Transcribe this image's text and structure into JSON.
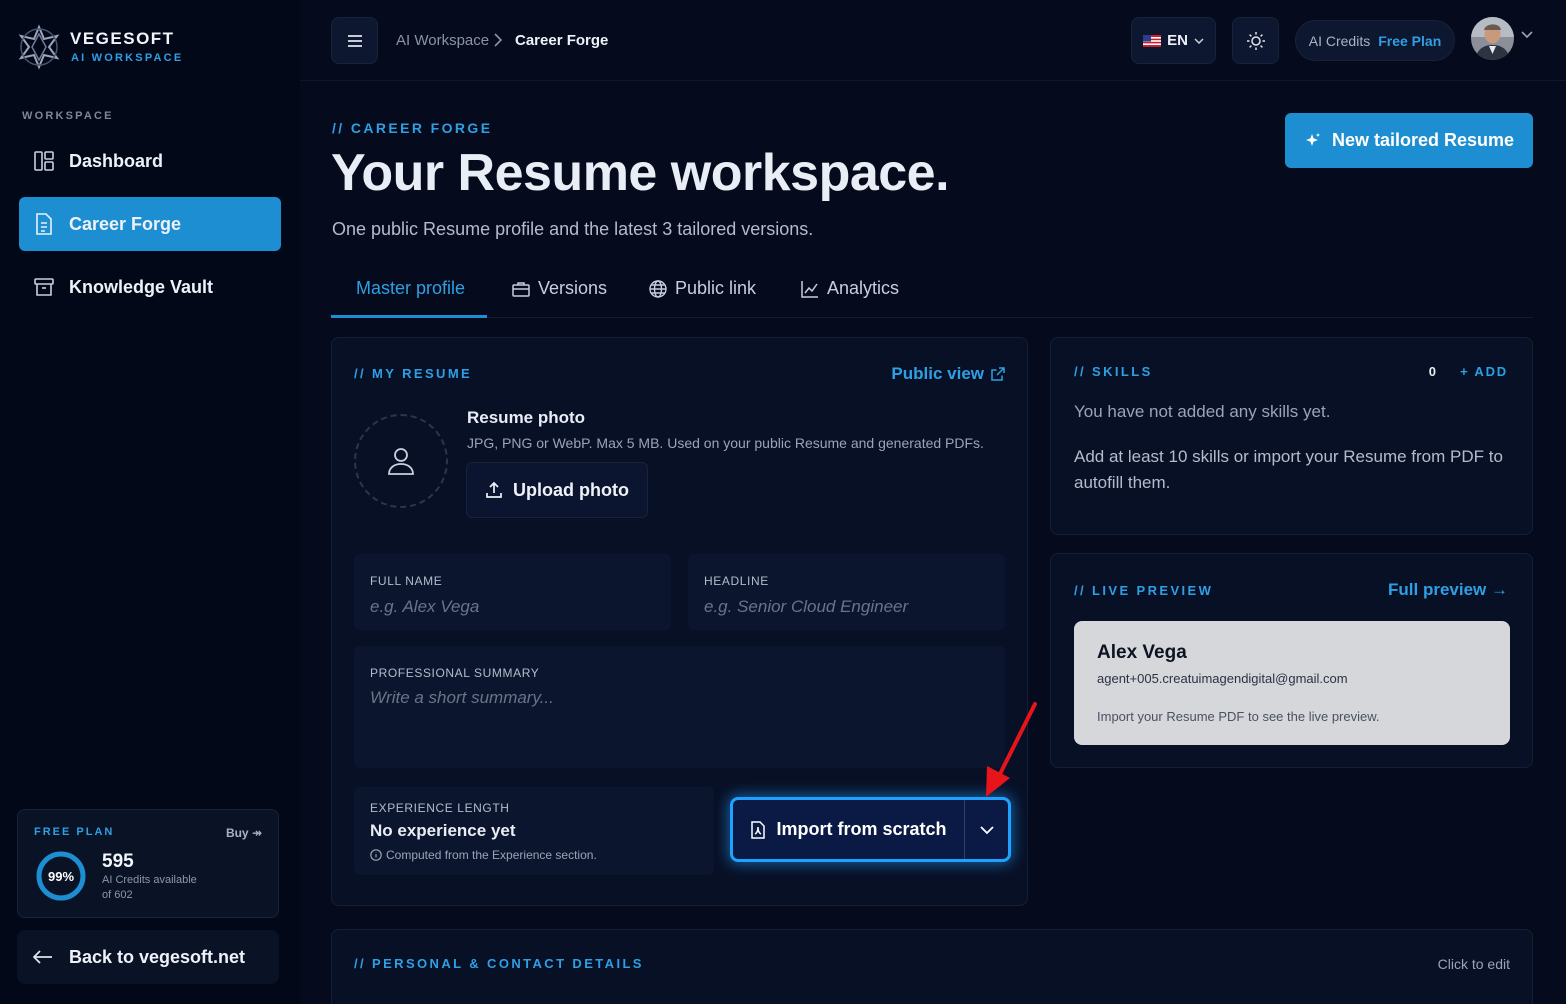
{
  "brand": {
    "name": "VEGESOFT",
    "subtitle": "AI WORKSPACE"
  },
  "sidebar": {
    "section_label": "WORKSPACE",
    "items": [
      {
        "label": "Dashboard",
        "icon": "layout-icon",
        "active": false
      },
      {
        "label": "Career Forge",
        "icon": "document-icon",
        "active": true
      },
      {
        "label": "Knowledge Vault",
        "icon": "archive-icon",
        "active": false
      }
    ],
    "plan": {
      "label": "FREE PLAN",
      "buy": "Buy ↠",
      "percent_text": "99%",
      "percent": 0.99,
      "credits": "595",
      "available_text": "AI Credits available",
      "of_text": "of 602"
    },
    "back_link": "Back to vegesoft.net"
  },
  "topbar": {
    "breadcrumb": [
      "AI Workspace",
      "Career Forge"
    ],
    "language": "EN",
    "credits_label": "AI Credits",
    "credits_plan": "Free Plan"
  },
  "header": {
    "eyebrow": "// CAREER FORGE",
    "title": "Your Resume workspace.",
    "subtitle": "One public Resume profile and the latest 3 tailored versions.",
    "new_button": "New tailored Resume"
  },
  "tabs": [
    {
      "label": "Master profile",
      "active": true
    },
    {
      "label": "Versions",
      "icon": "briefcase-icon"
    },
    {
      "label": "Public link",
      "icon": "globe-icon"
    },
    {
      "label": "Analytics",
      "icon": "chart-line-icon"
    }
  ],
  "resume": {
    "title": "// MY RESUME",
    "public_view": "Public view",
    "photo_title": "Resume photo",
    "photo_hint": "JPG, PNG or WebP. Max 5 MB. Used on your public Resume and generated PDFs.",
    "upload_button": "Upload photo",
    "full_name": {
      "label": "FULL NAME",
      "placeholder": "e.g. Alex Vega"
    },
    "headline": {
      "label": "HEADLINE",
      "placeholder": "e.g. Senior Cloud Engineer"
    },
    "summary": {
      "label": "PROFESSIONAL SUMMARY",
      "placeholder": "Write a short summary..."
    },
    "experience": {
      "label": "EXPERIENCE LENGTH",
      "value": "No experience yet",
      "note": "Computed from the Experience section."
    },
    "import_button": "Import from scratch"
  },
  "skills": {
    "title": "// SKILLS",
    "count": "0",
    "add": "+ ADD",
    "empty": "You have not added any skills yet.",
    "hint": "Add at least 10 skills or import your Resume from PDF to autofill them."
  },
  "preview": {
    "title": "// LIVE PREVIEW",
    "full_preview": "Full preview →",
    "name": "Alex Vega",
    "email": "agent+005.creatuimagendigital@gmail.com",
    "note": "Import your Resume PDF to see the live preview."
  },
  "contact": {
    "title": "// PERSONAL & CONTACT DETAILS",
    "click_edit": "Click to edit"
  },
  "colors": {
    "accent": "#1d8ed1",
    "link": "#2f9fe4",
    "background": "#050b1c",
    "annotation": "#e8141c"
  }
}
